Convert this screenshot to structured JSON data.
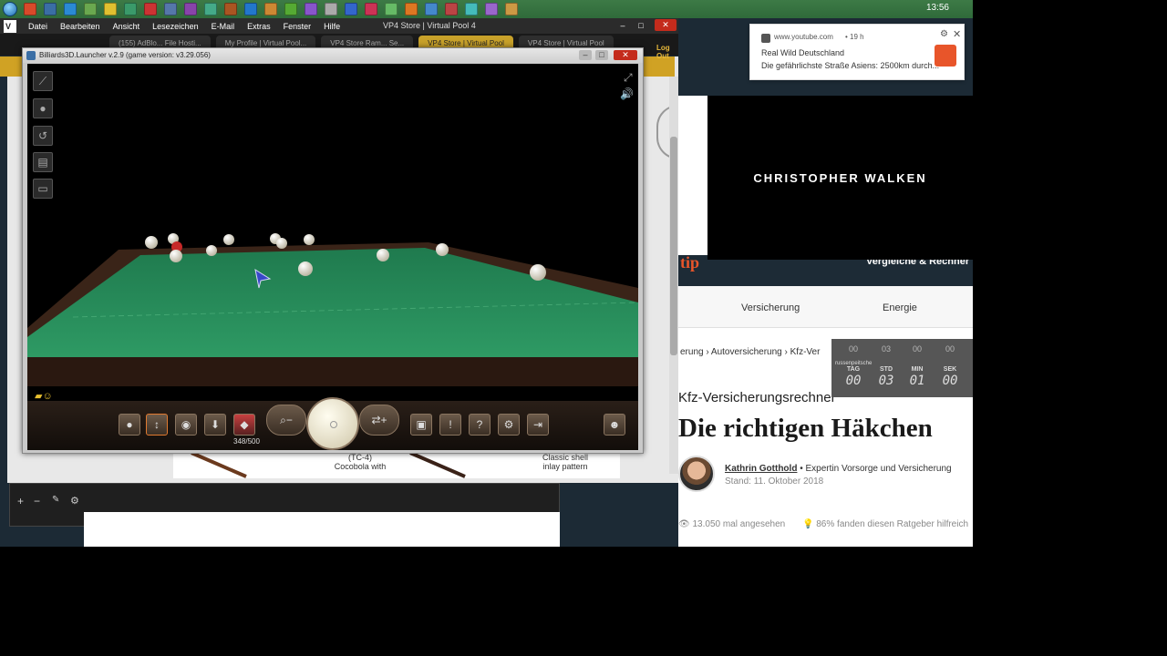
{
  "taskbar": {
    "clock": "13:56",
    "icon_colors": [
      "#d84a2a",
      "#3a6ea5",
      "#2a8ad4",
      "#6aa84f",
      "#e0c030",
      "#3a9a6a",
      "#cc3333",
      "#5577aa",
      "#8844aa",
      "#44aa88",
      "#aa5522",
      "#2277cc",
      "#cc8833",
      "#55aa33",
      "#8855cc",
      "#aaaaaa",
      "#3366cc",
      "#cc3355",
      "#66bb66",
      "#dd7722",
      "#4488cc",
      "#bb4444",
      "#44bbbb",
      "#9966cc",
      "#cc9944"
    ]
  },
  "menubar": {
    "items": [
      "Datei",
      "Bearbeiten",
      "Ansicht",
      "Lesezeichen",
      "E-Mail",
      "Extras",
      "Fenster",
      "Hilfe"
    ],
    "title": "VP4 Store | Virtual Pool 4"
  },
  "browser_tabs": [
    {
      "label": "(155) AdBlo... File Hosti...",
      "active": false
    },
    {
      "label": "My Profile | Virtual Pool...",
      "active": false
    },
    {
      "label": "VP4 Store Ram... Se...",
      "active": false
    },
    {
      "label": "VP4 Store | Virtual Pool",
      "active": true
    },
    {
      "label": "VP4 Store | Virtual Pool",
      "active": false
    }
  ],
  "billiards_window": {
    "title": "Billiards3D.Launcher v.2.9 (game version: v3.29.056)",
    "shot_counter": "348/500",
    "balls": [
      {
        "color": "#f0ead8"
      },
      {
        "color": "#f0ead8"
      },
      {
        "color": "#c62828"
      },
      {
        "color": "#f0ead8"
      },
      {
        "color": "#f0ead8"
      },
      {
        "color": "#f0ead8"
      },
      {
        "color": "#f0ead8"
      },
      {
        "color": "#f0ead8"
      },
      {
        "color": "#f0ead8"
      },
      {
        "color": "#f0ead8"
      },
      {
        "color": "#f0ead8"
      },
      {
        "color": "#f0ead8"
      }
    ]
  },
  "background_page": {
    "logout": "Log Out",
    "cue_labels": [
      "(TC-4)",
      "Cocobola with",
      "Classic shell",
      "inlay pattern"
    ]
  },
  "notification": {
    "site": "www.youtube.com",
    "age": "• 19 h",
    "channel": "Real Wild Deutschland",
    "text": "Die gefährlichste Straße Asiens: 2500km durch..."
  },
  "video": {
    "caption": "CHRISTOPHER WALKEN"
  },
  "right_page": {
    "logo": "tip",
    "tagline": "Vergleiche & Rechner",
    "nav": [
      "Versicherung",
      "Energie"
    ],
    "breadcrumb": [
      "erung",
      "Autoversicherung",
      "Kfz-Ver"
    ],
    "category": "Kfz-Versicherungsrechner",
    "headline": "Die richtigen Häkchen",
    "author_name": "Kathrin Gotthold",
    "author_role": "Expertin Vorsorge und Versicherung",
    "date": "Stand: 11. Oktober 2018",
    "views": "13.050 mal angesehen",
    "helpful": "86% fanden diesen Ratgeber hilfreich"
  },
  "countdown": {
    "title": "russenpeitsche",
    "labels": [
      "TAG",
      "STD",
      "MIN",
      "SEK"
    ],
    "values": [
      "00",
      "03",
      "01",
      "00"
    ],
    "top_values": [
      "00",
      "03",
      "00",
      "00"
    ]
  }
}
